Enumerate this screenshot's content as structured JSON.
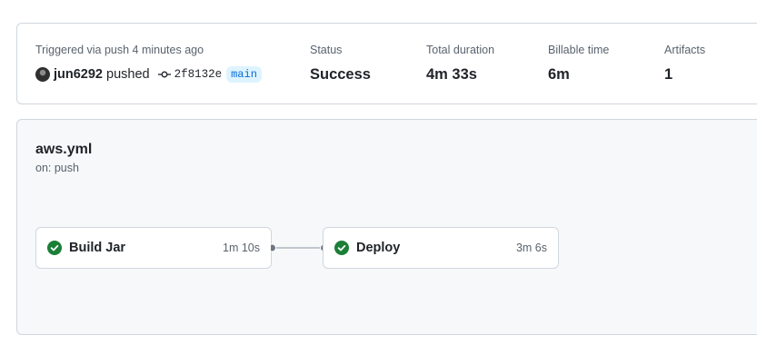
{
  "summary": {
    "trigger_label": "Triggered via push 4 minutes ago",
    "actor": "jun6292",
    "action": "pushed",
    "commit_sha": "2f8132e",
    "branch": "main",
    "status": {
      "label": "Status",
      "value": "Success"
    },
    "total_duration": {
      "label": "Total duration",
      "value": "4m 33s"
    },
    "billable_time": {
      "label": "Billable time",
      "value": "6m"
    },
    "artifacts": {
      "label": "Artifacts",
      "value": "1"
    }
  },
  "workflow": {
    "file": "aws.yml",
    "trigger": "on: push",
    "jobs": [
      {
        "name": "Build Jar",
        "duration": "1m 10s",
        "status": "success"
      },
      {
        "name": "Deploy",
        "duration": "3m 6s",
        "status": "success"
      }
    ]
  },
  "colors": {
    "success": "#1a7f37",
    "link": "#0969da",
    "muted": "#59636e",
    "border": "#d0d7de"
  }
}
